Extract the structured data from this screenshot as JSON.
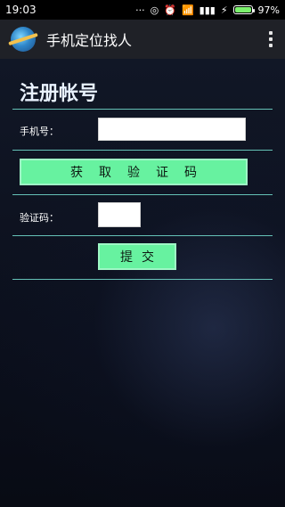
{
  "status_bar": {
    "time": "19:03",
    "icons": [
      "...",
      "sync-icon",
      "alarm-icon",
      "wifi-icon",
      "signal-icon",
      "charging-icon"
    ],
    "battery_level": 97,
    "battery_text": "97%",
    "battery_color": "#7CF26D"
  },
  "app_bar": {
    "title": "手机定位找人",
    "menu_icon": "overflow-menu-icon"
  },
  "page": {
    "title": "注册帐号"
  },
  "form": {
    "phone_label": "手机号：",
    "phone_value": "",
    "get_code_button": "获取验证码",
    "code_label": "验证码：",
    "code_value": "",
    "submit_button": "提交"
  },
  "colors": {
    "accent_line": "#6fd5c8",
    "button_bg": "#67f2a0"
  }
}
